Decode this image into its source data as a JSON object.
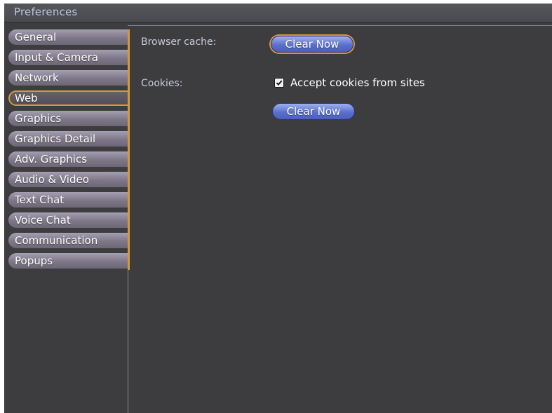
{
  "window": {
    "title": "Preferences"
  },
  "sidebar": {
    "items": [
      {
        "label": "General"
      },
      {
        "label": "Input & Camera"
      },
      {
        "label": "Network"
      },
      {
        "label": "Web"
      },
      {
        "label": "Graphics"
      },
      {
        "label": "Graphics Detail"
      },
      {
        "label": "Adv. Graphics"
      },
      {
        "label": "Audio & Video"
      },
      {
        "label": "Text Chat"
      },
      {
        "label": "Voice Chat"
      },
      {
        "label": "Communication"
      },
      {
        "label": "Popups"
      }
    ],
    "active": "Web"
  },
  "web": {
    "browser_cache_label": "Browser cache:",
    "clear_cache_button": "Clear Now",
    "cookies_label": "Cookies:",
    "accept_cookies_label": "Accept cookies from sites",
    "accept_cookies_checked": true,
    "clear_cookies_button": "Clear Now"
  },
  "colors": {
    "accent": "#d49a3a",
    "button": "#5b70cc",
    "panel": "#3d3d40"
  },
  "icons": {
    "checkbox": "checkmark-icon"
  }
}
